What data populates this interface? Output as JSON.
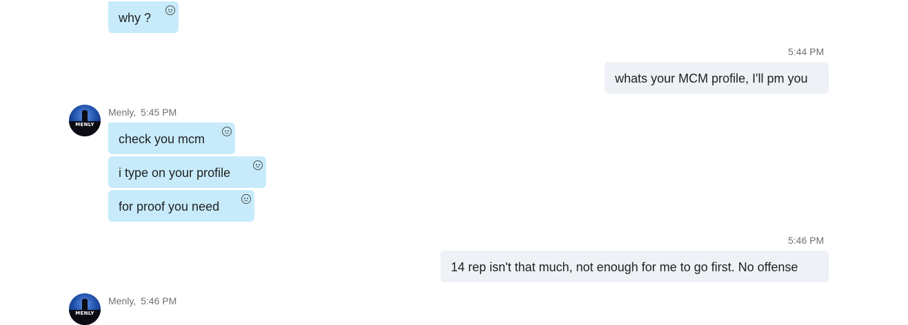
{
  "chat": {
    "msg_why": "why ?",
    "time_1": "5:44 PM",
    "msg_mcm_profile": "whats your MCM profile, I'll pm you",
    "sender_1": "Menly,",
    "sender_1_time": "5:45 PM",
    "msg_check": "check you mcm",
    "msg_type": "i type on your profile",
    "msg_proof": "for proof you need",
    "time_2": "5:46 PM",
    "msg_rep": "14 rep isn't that much, not enough for me to go first. No offense",
    "sender_2": "Menly,",
    "sender_2_time": "5:46 PM",
    "avatar_text": "MENLY"
  },
  "colors": {
    "incoming_bubble": "#c7ebfb",
    "outgoing_bubble": "#eef1f6",
    "meta_text": "#6c6f73"
  },
  "icons": {
    "reaction": "smiley-face-icon",
    "avatar": "menly-avatar"
  }
}
